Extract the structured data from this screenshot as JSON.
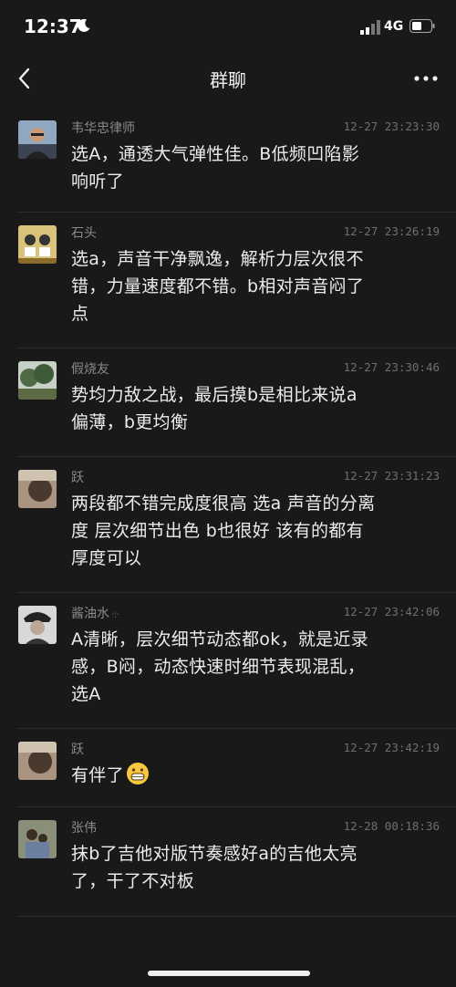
{
  "status": {
    "time": "12:37",
    "network": "4G"
  },
  "nav": {
    "title": "群聊"
  },
  "messages": [
    {
      "name": "韦华忠律师",
      "time": "12-27 23:23:30",
      "lines": [
        "选A，通透大气弹性佳。B低频凹陷影",
        "响听了"
      ],
      "avatar": "man-photo"
    },
    {
      "name": "石头",
      "time": "12-27 23:26:19",
      "lines": [
        "选a，声音干净飘逸，解析力层次很不",
        "错，力量速度都不错。b相对声音闷了",
        "点"
      ],
      "avatar": "cartoon-figures"
    },
    {
      "name": "假烧友",
      "time": "12-27 23:30:46",
      "lines": [
        "势均力敌之战，最后摸b是相比来说a",
        "偏薄，b更均衡"
      ],
      "avatar": "landscape-trees"
    },
    {
      "name": "跃",
      "time": "12-27 23:31:23",
      "lines": [
        "两段都不错完成度很高 选a 声音的分离",
        "度 层次细节出色 b也很好 该有的都有",
        "厚度可以"
      ],
      "avatar": "blurry-photo"
    },
    {
      "name": "酱油水",
      "time": "12-27 23:42:06",
      "lines": [
        "A清晰，层次细节动态都ok，就是近录",
        "感，B闷，动态快速时细节表现混乱，",
        "选A"
      ],
      "avatar": "portrait-hat"
    },
    {
      "name": "跃",
      "time": "12-27 23:42:19",
      "lines": [
        "有伴了"
      ],
      "avatar": "blurry-photo",
      "emoji": "grinning-face-icon"
    },
    {
      "name": "张伟",
      "time": "12-28 00:18:36",
      "lines": [
        "抹b了吉他对版节奏感好a的吉他太亮",
        "了，干了不对板"
      ],
      "avatar": "kids-photo"
    }
  ],
  "colors": {
    "background": "#191919",
    "text": "#ececec",
    "meta": "#8a8a8a",
    "divider": "#2c2c2c"
  }
}
